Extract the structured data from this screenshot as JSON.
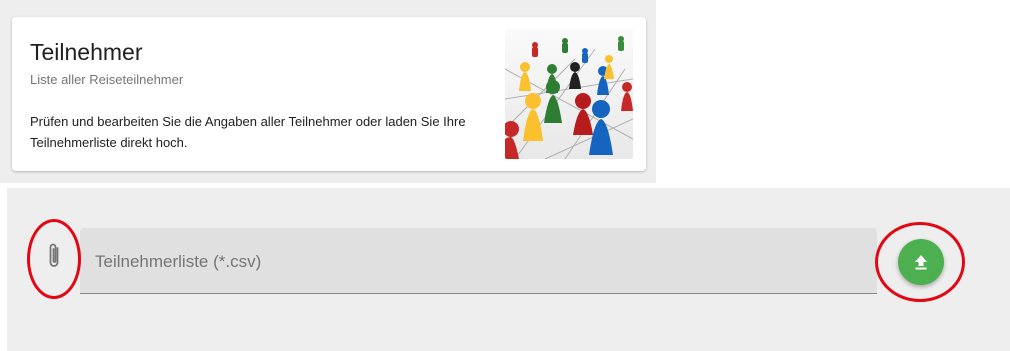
{
  "card": {
    "title": "Teilnehmer",
    "subtitle": "Liste aller Reiseteilnehmer",
    "description": "Prüfen und bearbeiten Sie die Angaben aller Teilnehmer oder laden Sie Ihre Teilnehmerliste direkt hoch.",
    "image_icon": "board-game-pawns-image"
  },
  "upload": {
    "attach_icon": "paperclip-icon",
    "field_label": "Teilnehmerliste (*.csv)",
    "button_icon": "upload-arrow-icon",
    "button_color": "#4caf50"
  },
  "annotations": {
    "highlight_color": "#e30613"
  },
  "colors": {
    "background": "#eeeeee",
    "field_background": "#e0e0e0"
  }
}
